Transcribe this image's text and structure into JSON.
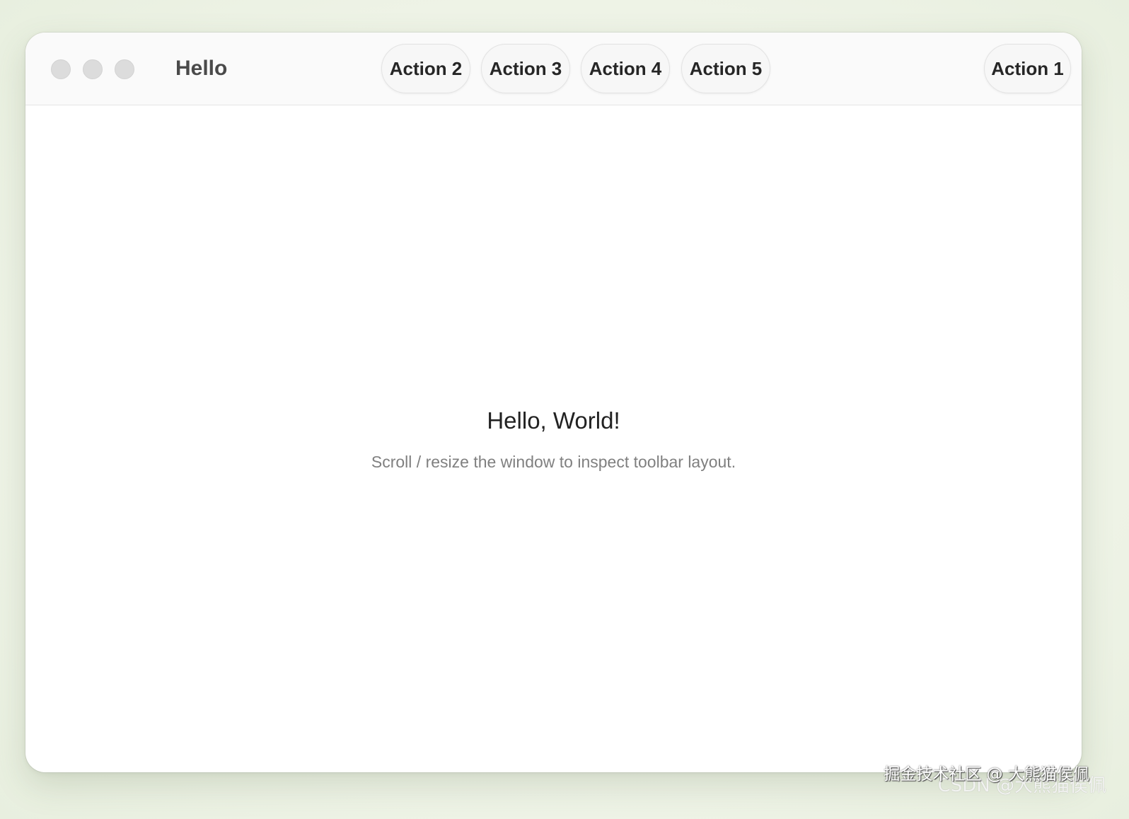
{
  "window": {
    "title": "Hello"
  },
  "toolbar": {
    "actions": [
      {
        "label": "Action 2"
      },
      {
        "label": "Action 3"
      },
      {
        "label": "Action 4"
      },
      {
        "label": "Action 5"
      }
    ],
    "trailing_action": {
      "label": "Action 1"
    }
  },
  "content": {
    "heading": "Hello, World!",
    "subtitle": "Scroll / resize the window to inspect toolbar layout."
  },
  "watermarks": {
    "primary": "掘金技术社区 @ 大熊猫侯佩",
    "secondary": "CSDN @大熊猫侯佩"
  },
  "colors": {
    "traffic_light_inactive": "#dcdcdc",
    "window_background": "#ffffff",
    "page_background": "#eef3e6"
  },
  "icons": {
    "traffic_lights": [
      "close-icon",
      "minimize-icon",
      "zoom-icon"
    ]
  }
}
